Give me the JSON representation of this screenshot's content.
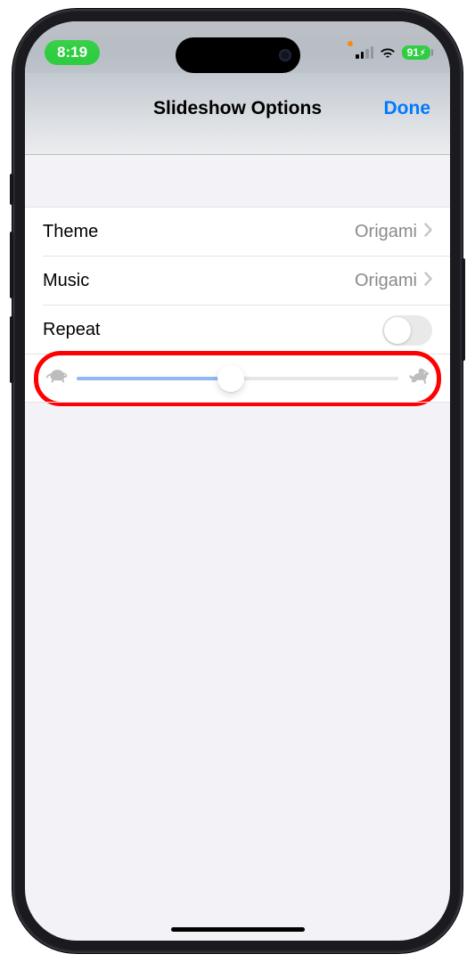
{
  "status": {
    "time": "8:19",
    "battery": "91"
  },
  "nav": {
    "title": "Slideshow Options",
    "done": "Done"
  },
  "rows": {
    "theme": {
      "label": "Theme",
      "value": "Origami"
    },
    "music": {
      "label": "Music",
      "value": "Origami"
    },
    "repeat": {
      "label": "Repeat",
      "on": false
    },
    "speed": {
      "value_percent": 48
    }
  }
}
